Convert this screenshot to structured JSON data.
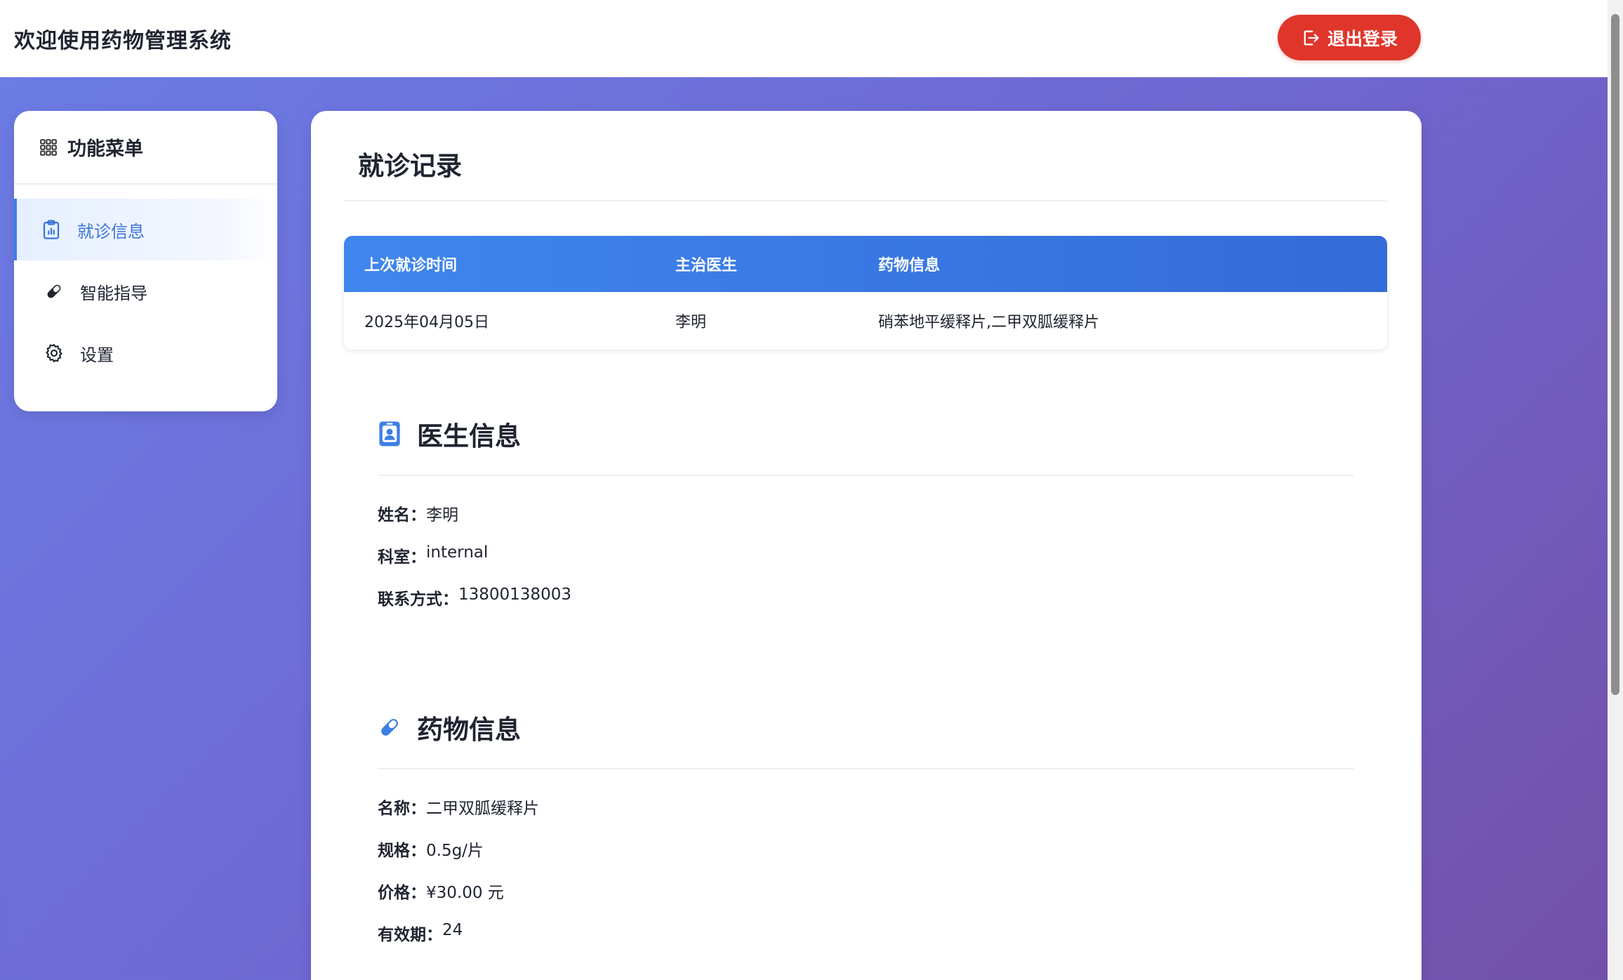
{
  "header": {
    "title": "欢迎使用药物管理系统",
    "logout_label": "退出登录"
  },
  "sidebar": {
    "title": "功能菜单",
    "items": [
      {
        "label": "就诊信息",
        "icon": "clipboard-chart-icon",
        "active": true
      },
      {
        "label": "智能指导",
        "icon": "pill-icon",
        "active": false
      },
      {
        "label": "设置",
        "icon": "gear-icon",
        "active": false
      }
    ]
  },
  "main": {
    "title": "就诊记录",
    "records": {
      "headers": [
        "上次就诊时间",
        "主治医生",
        "药物信息"
      ],
      "rows": [
        [
          "2025年04月05日",
          "李明",
          "硝苯地平缓释片,二甲双胍缓释片"
        ]
      ]
    },
    "doctor": {
      "title": "医生信息",
      "icon": "doctor-badge-icon",
      "fields": [
        {
          "key": "姓名：",
          "value": "李明"
        },
        {
          "key": "科室：",
          "value": "internal"
        },
        {
          "key": "联系方式：",
          "value": "13800138003"
        }
      ]
    },
    "drug": {
      "title": "药物信息",
      "icon": "pill-icon",
      "fields": [
        {
          "key": "名称：",
          "value": "二甲双胍缓释片"
        },
        {
          "key": "规格：",
          "value": "0.5g/片"
        },
        {
          "key": "价格：",
          "value": "¥30.00 元"
        },
        {
          "key": "有效期：",
          "value": "24"
        }
      ]
    }
  },
  "colors": {
    "accent": "#3d7fe6",
    "danger": "#e0352b",
    "bg_gradient_start": "#6b7de6",
    "bg_gradient_end": "#7350a8"
  }
}
